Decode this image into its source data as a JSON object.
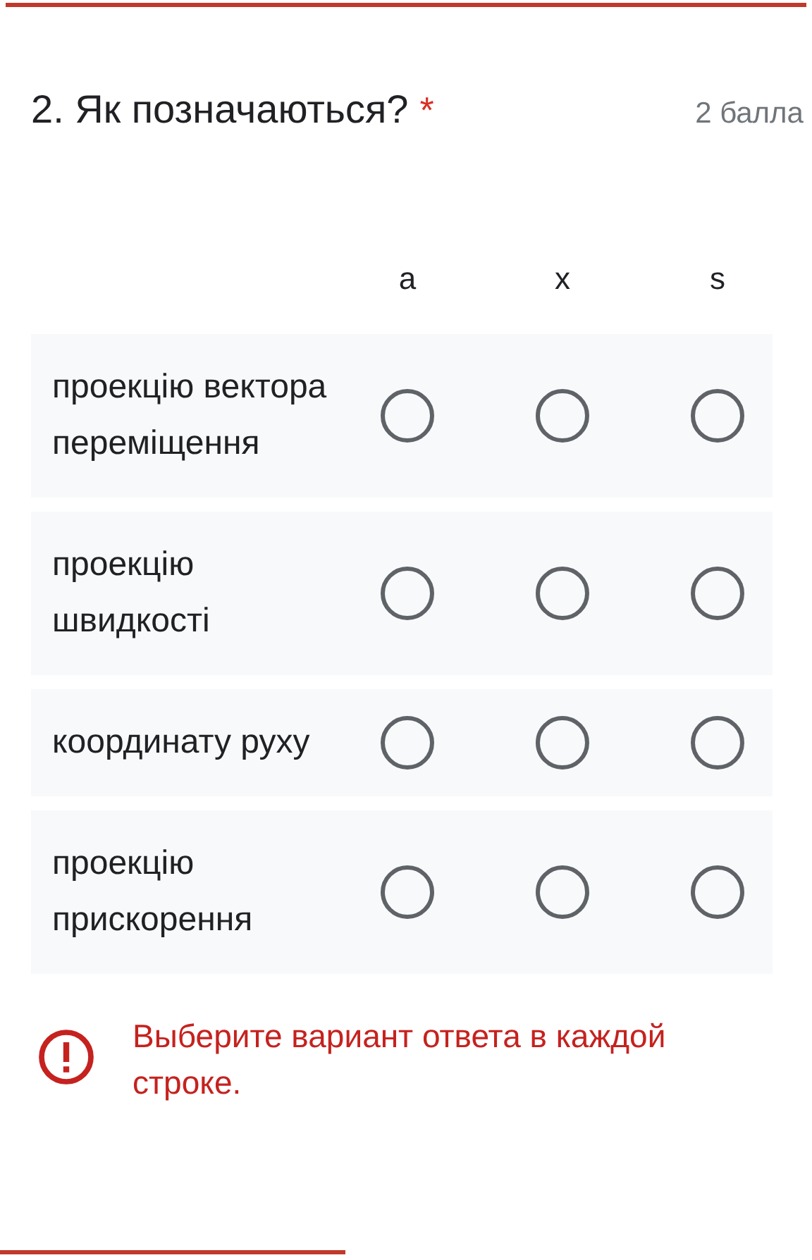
{
  "question": {
    "title": "2. Як позначаються?",
    "required_mark": "*",
    "points": "2 балла"
  },
  "columns": [
    "a",
    "x",
    "s"
  ],
  "rows": [
    {
      "label": "проекцію вектора переміщення",
      "options": [
        {
          "selected": false
        },
        {
          "selected": false
        },
        {
          "selected": false
        }
      ]
    },
    {
      "label": "проекцію швидкості",
      "options": [
        {
          "selected": false
        },
        {
          "selected": false
        },
        {
          "selected": false
        }
      ]
    },
    {
      "label": "координату руху",
      "options": [
        {
          "selected": false
        },
        {
          "selected": false
        },
        {
          "selected": false
        }
      ]
    },
    {
      "label": "проекцію прискорення",
      "options": [
        {
          "selected": false
        },
        {
          "selected": false
        },
        {
          "selected": false
        }
      ]
    }
  ],
  "error": "Выберите вариант ответа в каждой строке."
}
